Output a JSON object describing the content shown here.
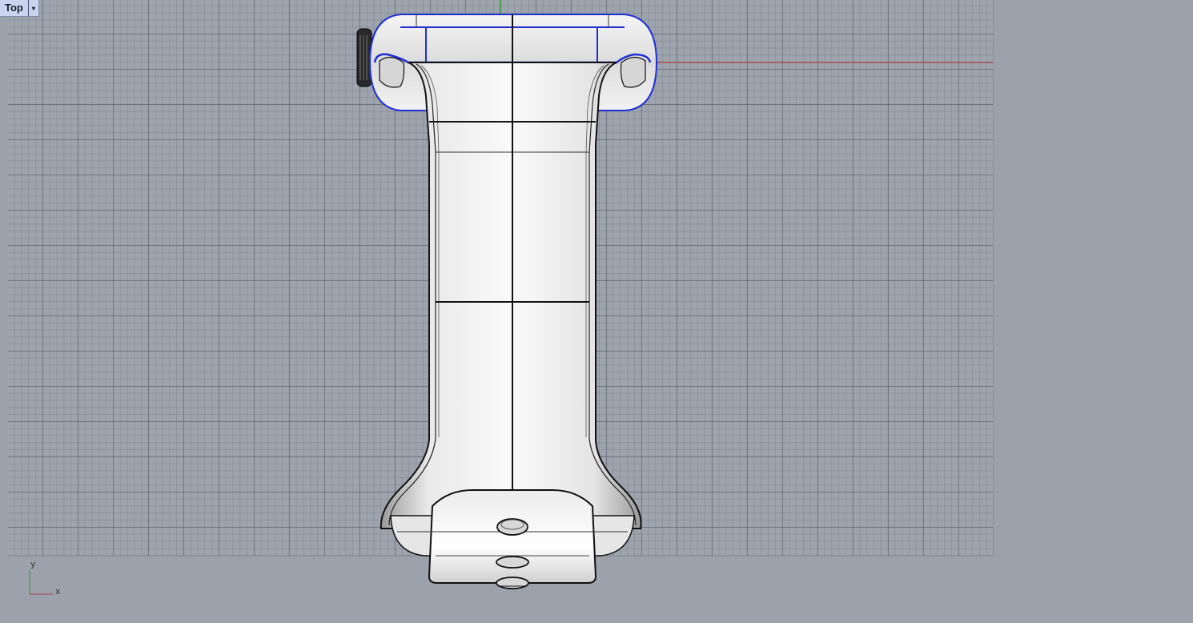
{
  "viewport": {
    "title": "Top",
    "menu_arrow": "▾"
  },
  "axis": {
    "y_label": "y",
    "x_label": "x",
    "y_color": "#44aa44",
    "x_color": "#c04040"
  },
  "colors": {
    "background": "#9ba2ab",
    "selection": "#1f2fd6",
    "model_edge": "#111111"
  }
}
